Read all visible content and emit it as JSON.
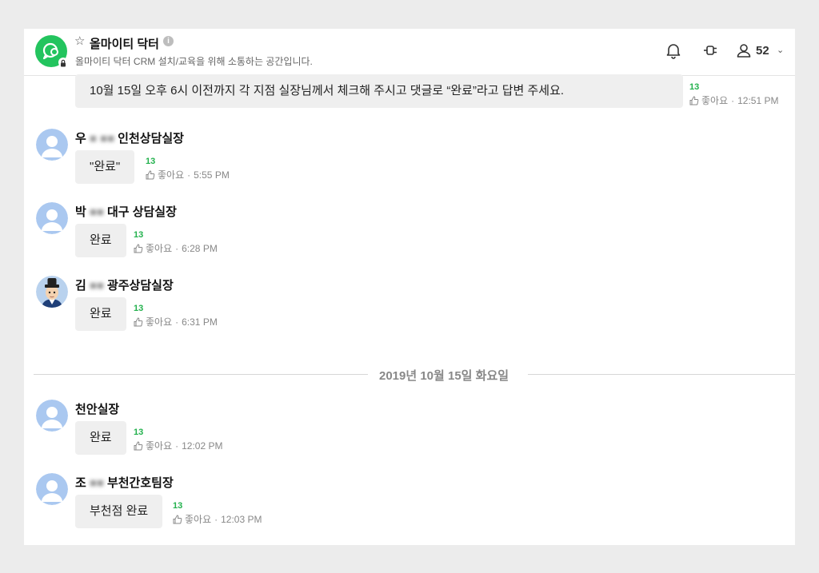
{
  "header": {
    "title": "올마이티 닥터",
    "info_glyph": "i",
    "star_glyph": "☆",
    "description": "올마이티 닥터 CRM 설치/교육을 위해 소통하는 공간입니다.",
    "member_count": "52",
    "chevron_glyph": "⌄",
    "icons": [
      "chat-logo-icon",
      "lock-icon",
      "star-icon",
      "info-icon",
      "bell-icon",
      "plug-icon",
      "person-icon",
      "chevron-down-icon"
    ],
    "accent_color": "#23c45e"
  },
  "top_message": {
    "text": "10월 15일 오후 6시 이전까지 각 지점 실장님께서 체크해 주시고 댓글로 “완료”라고 답변 주세요.",
    "likes": "13",
    "like_label": "좋아요",
    "time": "12:51 PM"
  },
  "messages": [
    {
      "name_prefix": "우",
      "name_blur": "■ ■■",
      "name_suffix": "인천상담실장",
      "text": "\"완료\"",
      "likes": "13",
      "like_label": "좋아요",
      "time": "5:55 PM",
      "avatar": "default-avatar"
    },
    {
      "name_prefix": "박",
      "name_blur": "■■",
      "name_suffix": "대구 상담실장",
      "text": "완료",
      "likes": "13",
      "like_label": "좋아요",
      "time": "6:28 PM",
      "avatar": "default-avatar"
    },
    {
      "name_prefix": "김",
      "name_blur": "■■",
      "name_suffix": "광주상담실장",
      "text": "완료",
      "likes": "13",
      "like_label": "좋아요",
      "time": "6:31 PM",
      "avatar": "character-avatar"
    },
    {
      "name_prefix": "",
      "name_blur": "",
      "name_suffix": "천안실장",
      "text": "완료",
      "likes": "13",
      "like_label": "좋아요",
      "time": "12:02 PM",
      "avatar": "default-avatar"
    },
    {
      "name_prefix": "조",
      "name_blur": "■■",
      "name_suffix": "부천간호팀장",
      "text": "부천점 완료",
      "likes": "13",
      "like_label": "좋아요",
      "time": "12:03 PM",
      "avatar": "default-avatar"
    }
  ],
  "date_divider": "2019년 10월 15일 화요일",
  "separator_dot": "·"
}
